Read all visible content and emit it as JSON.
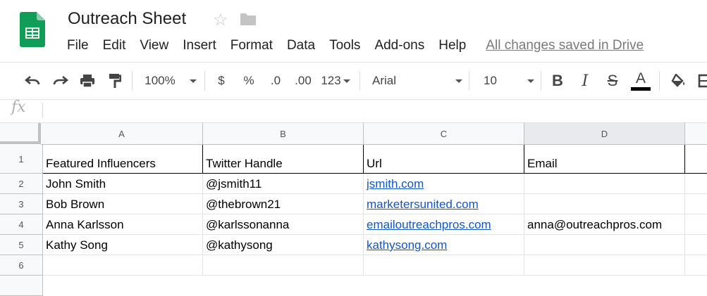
{
  "app": {
    "title": "Outreach Sheet",
    "saved_status": "All changes saved in Drive"
  },
  "menu": [
    "File",
    "Edit",
    "View",
    "Insert",
    "Format",
    "Data",
    "Tools",
    "Add-ons",
    "Help"
  ],
  "toolbar": {
    "zoom": "100%",
    "currency": "$",
    "percent": "%",
    "decrease_decimal": ".0",
    "increase_decimal": ".00",
    "more_formats": "123",
    "font": "Arial",
    "font_size": "10",
    "bold": "B",
    "italic": "I",
    "strike": "S",
    "text_color": "A",
    "text_color_value": "#000000"
  },
  "formula_bar": {
    "label": "fx",
    "value": ""
  },
  "columns": [
    "A",
    "B",
    "C",
    "D"
  ],
  "rows": [
    {
      "num": "1",
      "cells": [
        "Featured Influencers",
        "Twitter Handle",
        "Url",
        "Email"
      ]
    },
    {
      "num": "2",
      "cells": [
        "John Smith",
        "@jsmith11",
        "jsmith.com",
        ""
      ]
    },
    {
      "num": "3",
      "cells": [
        "Bob Brown",
        "@thebrown21",
        "marketersunited.com",
        ""
      ]
    },
    {
      "num": "4",
      "cells": [
        "Anna Karlsson",
        "@karlssonanna",
        "emailoutreachpros.com",
        "anna@outreachpros.com"
      ]
    },
    {
      "num": "5",
      "cells": [
        "Kathy Song",
        "@kathysong",
        "kathysong.com",
        ""
      ]
    },
    {
      "num": "6",
      "cells": [
        "",
        "",
        "",
        ""
      ]
    }
  ],
  "colors": {
    "link": "#1155cc",
    "brand_green": "#0f9d58"
  }
}
